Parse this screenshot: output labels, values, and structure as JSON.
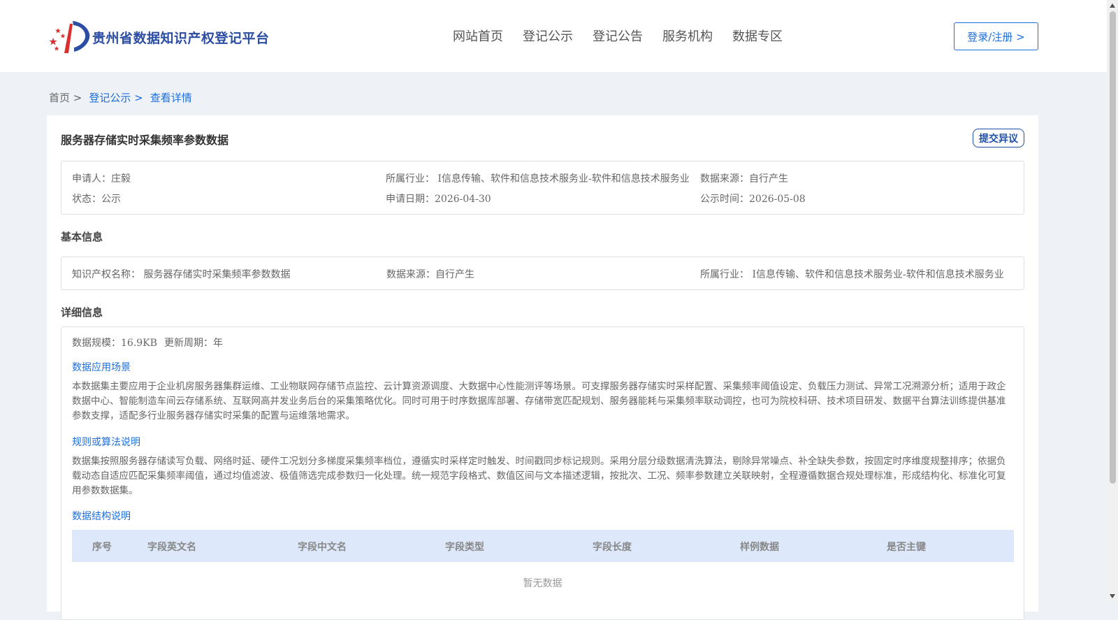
{
  "header": {
    "site_name": "贵州省数据知识产权登记平台",
    "nav": [
      "网站首页",
      "登记公示",
      "登记公告",
      "服务机构",
      "数据专区"
    ],
    "login_label": "登录/注册 >"
  },
  "breadcrumb": [
    "首页 >",
    "登记公示 >",
    "查看详情"
  ],
  "detail": {
    "title": "服务器存储实时采集频率参数数据",
    "objection_label": "提交异议",
    "summary": {
      "applicant": "申请人：庄毅",
      "industry": "所属行业： I信息传输、软件和信息技术服务业-软件和信息技术服务业",
      "source": "数据来源：自行产生",
      "status": "状态：公示",
      "apply_date": "申请日期：2026-04-30",
      "publish_date": "公示时间：2026-05-08"
    },
    "basic": {
      "heading": "基本信息",
      "ip_name": "知识产权名称： 服务器存储实时采集频率参数数据",
      "source": "数据来源：自行产生",
      "industry": "所属行业： I信息传输、软件和信息技术服务业-软件和信息技术服务业"
    },
    "more": {
      "heading": "详细信息",
      "scale": "数据规模：16.9KB",
      "cycle": "更新周期：年",
      "scenario_heading": "数据应用场景",
      "scenario_text": "本数据集主要应用于企业机房服务器集群运维、工业物联网存储节点监控、云计算资源调度、大数据中心性能测评等场景。可支撑服务器存储实时采样配置、采集频率阈值设定、负载压力测试、异常工况溯源分析；适用于政企数据中心、智能制造车间云存储系统、互联网高并发业务后台的采集策略优化。同时可用于时序数据库部署、存储带宽匹配规划、服务器能耗与采集频率联动调控，也可为院校科研、技术项目研发、数据平台算法训练提供基准参数支撑，适配多行业服务器存储实时采集的配置与运维落地需求。",
      "rules_heading": "规则或算法说明",
      "rules_text": "数据集按照服务器存储读写负载、网络时延、硬件工况划分多梯度采集频率档位，遵循实时采样定时触发、时间戳同步标记规则。采用分层分级数据清洗算法，剔除异常噪点、补全缺失参数，按固定时序维度规整排序；依据负载动态自适应匹配采集频率阈值，通过均值滤波、极值筛选完成参数归一化处理。统一规范字段格式、数值区间与文本描述逻辑，按批次、工况、频率参数建立关联映射，全程遵循数据合规处理标准，形成结构化、标准化可复用参数数据集。",
      "structure_heading": "数据结构说明",
      "table_headers": [
        "序号",
        "字段英文名",
        "字段中文名",
        "字段类型",
        "字段长度",
        "样例数据",
        "是否主键"
      ],
      "empty_text": "暂无数据"
    }
  },
  "colors": {
    "brand": "#2b4da3",
    "link": "#1e6fd9",
    "table_header_bg": "#dde9fb"
  }
}
